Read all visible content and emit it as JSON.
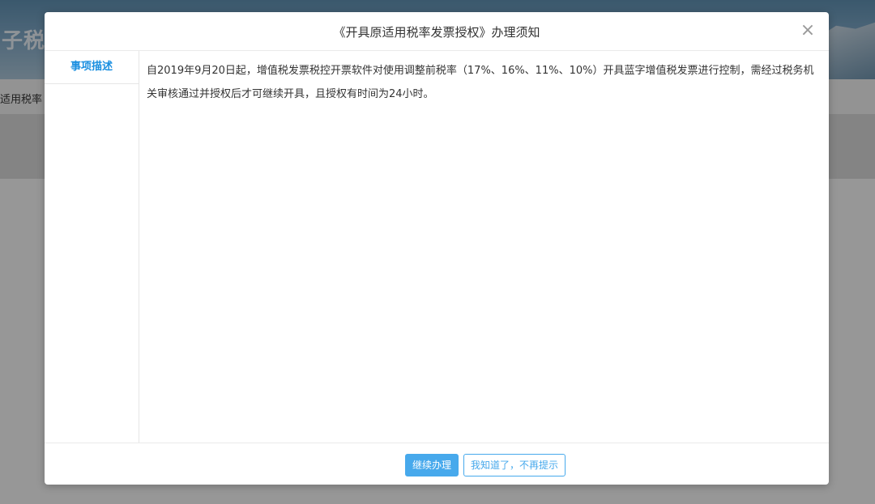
{
  "background": {
    "site_title_fragment": "子税",
    "nav_text_fragment": "适用税率"
  },
  "modal": {
    "title": "《开具原适用税率发票授权》办理须知",
    "close_icon": "close-icon",
    "sidebar": {
      "items": [
        {
          "label": "事项描述",
          "active": true
        }
      ]
    },
    "content": {
      "text": "自2019年9月20日起，增值税发票税控开票软件对使用调整前税率（17%、16%、11%、10%）开具蓝字增值税发票进行控制，需经过税务机关审核通过并授权后才可继续开具，且授权有时间为24小时。"
    },
    "footer": {
      "primary_label": "继续办理",
      "secondary_label": "我知道了，不再提示"
    }
  },
  "colors": {
    "accent": "#47a9ec",
    "tab_active": "#1a8fe0"
  }
}
